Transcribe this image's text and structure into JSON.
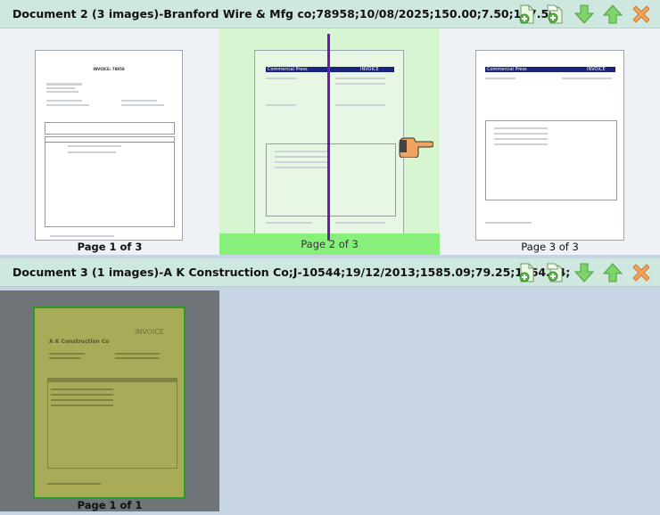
{
  "documents": [
    {
      "title": "Document 2 (3 images)-Branford Wire & Mfg co;78958;10/08/2025;150.00;7.50;157.50;",
      "pages": [
        {
          "label": "Page 1 of 3"
        },
        {
          "label": "Page 2 of 3"
        },
        {
          "label": "Page 3 of 3"
        }
      ]
    },
    {
      "title": "Document 3 (1 images)-A K Construction Co;J-10544;19/12/2013;1585.09;79.25;1664.34;",
      "pages": [
        {
          "label": "Page 1 of 1"
        }
      ]
    }
  ],
  "thumbnails": {
    "invoice1_title": "INVOICE: 78958",
    "commercial_press": "Commercial Press",
    "invoice_word": "INVOICE",
    "ak_company": "A K Construction Co"
  },
  "toolbar_icons": [
    "add-page-icon",
    "insert-page-icon",
    "move-down-icon",
    "move-up-icon",
    "delete-icon"
  ],
  "colors": {
    "header_bg": "#cfe8df",
    "selected_page_bg": "#d6f5d0",
    "selected_label_bg": "#88f07a",
    "drop_cursor": "#6a1bb5",
    "selected_thumb_border": "#2e9a1e",
    "dim_overlay": "#6f7478"
  }
}
